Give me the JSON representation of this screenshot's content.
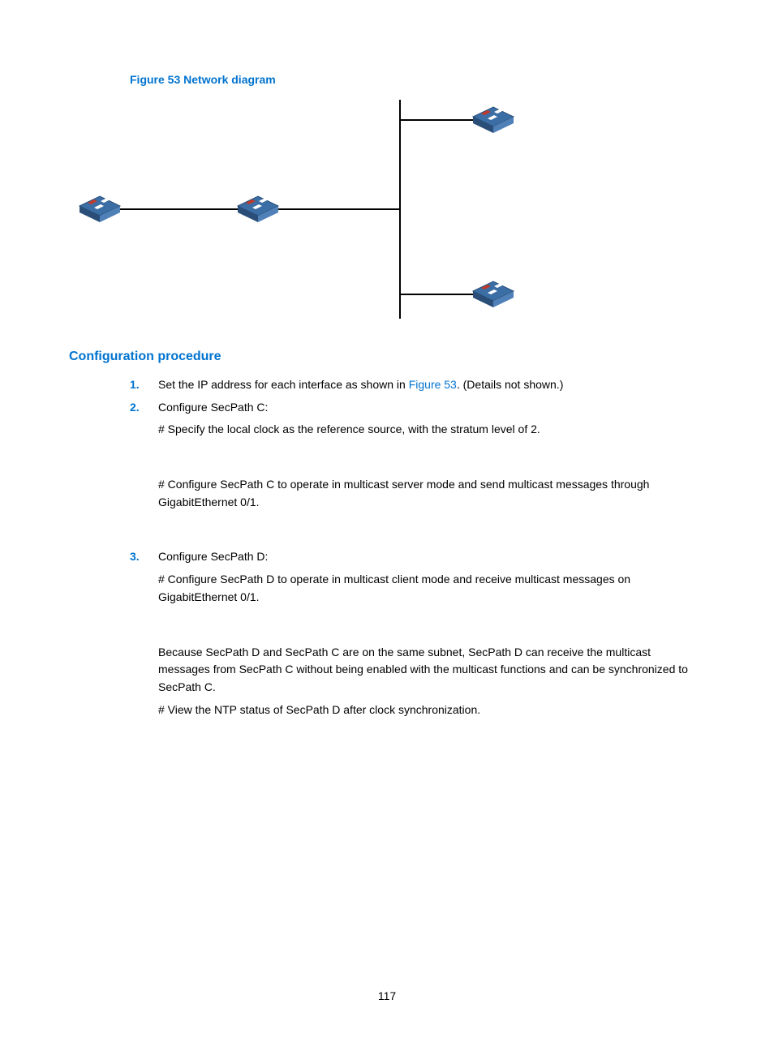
{
  "figureCaption": "Figure 53 Network diagram",
  "sectionHeading": "Configuration procedure",
  "steps": [
    {
      "marker": "1.",
      "prefix": "Set the IP address for each interface as shown in ",
      "link": "Figure 53",
      "suffix": ". (Details not shown.)"
    },
    {
      "marker": "2.",
      "title": "Configure SecPath C:",
      "block1": "# Specify the local clock as the reference source, with the stratum level of 2.",
      "block2": "# Configure SecPath C to operate in multicast server mode and send multicast messages through GigabitEthernet 0/1."
    },
    {
      "marker": "3.",
      "title": "Configure SecPath D:",
      "block1": "# Configure SecPath D to operate in multicast client mode and receive multicast messages on GigabitEthernet 0/1.",
      "block2": "Because SecPath D and SecPath C are on the same subnet, SecPath D can receive the multicast messages from SecPath C without being enabled with the multicast functions and can be synchronized to SecPath C.",
      "block3": "# View the NTP status of SecPath D after clock synchronization."
    }
  ],
  "pageNumber": "117"
}
